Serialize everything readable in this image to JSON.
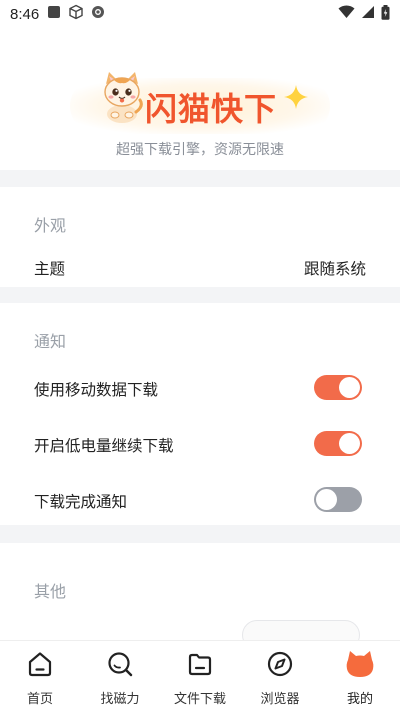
{
  "status_bar": {
    "time": "8:46",
    "icons": [
      "square-icon",
      "cube-icon",
      "at-icon",
      "wifi-icon",
      "signal-icon",
      "battery-icon"
    ]
  },
  "header": {
    "brand": "闪猫快下",
    "slogan": "超强下载引擎，资源无限速"
  },
  "appearance": {
    "title": "外观",
    "theme_label": "主题",
    "theme_value": "跟随系统"
  },
  "notifications": {
    "title": "通知",
    "items": [
      {
        "label": "使用移动数据下载",
        "enabled": true
      },
      {
        "label": "开启低电量继续下载",
        "enabled": true
      },
      {
        "label": "下载完成通知",
        "enabled": false
      }
    ]
  },
  "other": {
    "title": "其他"
  },
  "bottom_nav": {
    "items": [
      {
        "label": "首页",
        "icon": "home-icon"
      },
      {
        "label": "找磁力",
        "icon": "search-icon"
      },
      {
        "label": "文件下载",
        "icon": "folder-icon"
      },
      {
        "label": "浏览器",
        "icon": "compass-icon"
      },
      {
        "label": "我的",
        "icon": "cat-avatar-icon"
      }
    ],
    "active_index": 4
  },
  "colors": {
    "accent": "#f26b4a",
    "brand": "#f0552d",
    "toggle_off": "#9ca0a8",
    "section_title": "#9aa0a8"
  }
}
